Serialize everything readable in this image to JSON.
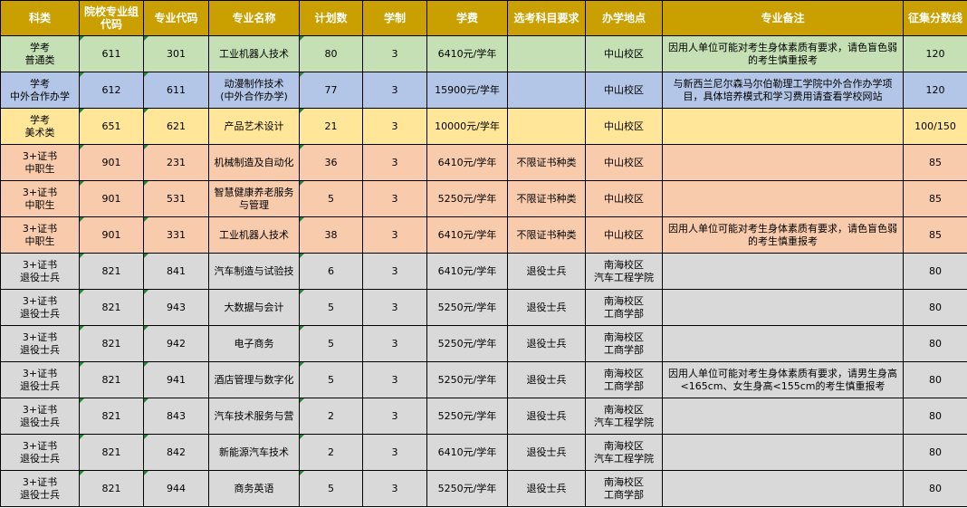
{
  "headers": [
    "科类",
    "院校专业组代码",
    "专业代码",
    "专业名称",
    "计划数",
    "学制",
    "学费",
    "选考科目要求",
    "办学地点",
    "专业备注",
    "征集分数线"
  ],
  "rows": [
    {
      "category": "学考\n普通类",
      "group_code": "611",
      "major_code": "301",
      "major_name": "工业机器人技术",
      "plan": "80",
      "years": "3",
      "tuition": "6410元/学年",
      "subject_req": "",
      "campus": "中山校区",
      "note": "因用人单位可能对考生身体素质有要求，请色盲色弱的考生慎重报考",
      "score": "120"
    },
    {
      "category": "学考\n中外合作办学",
      "group_code": "612",
      "major_code": "611",
      "major_name": "动漫制作技术\n(中外合作办学)",
      "plan": "77",
      "years": "3",
      "tuition": "15900元/学年",
      "subject_req": "",
      "campus": "中山校区",
      "note": "与新西兰尼尔森马尔伯勒理工学院中外合作办学项目，具体培养模式和学习费用请查看学校网站",
      "score": "120"
    },
    {
      "category": "学考\n美术类",
      "group_code": "651",
      "major_code": "621",
      "major_name": "产品艺术设计",
      "plan": "21",
      "years": "3",
      "tuition": "10000元/学年",
      "subject_req": "",
      "campus": "中山校区",
      "note": "",
      "score": "100/150"
    },
    {
      "category": "3+证书\n中职生",
      "group_code": "901",
      "major_code": "231",
      "major_name": "机械制造及自动化",
      "plan": "36",
      "years": "3",
      "tuition": "6410元/学年",
      "subject_req": "不限证书种类",
      "campus": "中山校区",
      "note": "",
      "score": "85"
    },
    {
      "category": "3+证书\n中职生",
      "group_code": "901",
      "major_code": "531",
      "major_name": "智慧健康养老服务与管理",
      "plan": "5",
      "years": "3",
      "tuition": "5250元/学年",
      "subject_req": "不限证书种类",
      "campus": "中山校区",
      "note": "",
      "score": "85"
    },
    {
      "category": "3+证书\n中职生",
      "group_code": "901",
      "major_code": "331",
      "major_name": "工业机器人技术",
      "plan": "38",
      "years": "3",
      "tuition": "6410元/学年",
      "subject_req": "不限证书种类",
      "campus": "中山校区",
      "note": "因用人单位可能对考生身体素质有要求，请色盲色弱的考生慎重报考",
      "score": "85"
    },
    {
      "category": "3+证书\n退役士兵",
      "group_code": "821",
      "major_code": "841",
      "major_name": "汽车制造与试验技",
      "plan": "6",
      "years": "3",
      "tuition": "6410元/学年",
      "subject_req": "退役士兵",
      "campus": "南海校区\n汽车工程学院",
      "note": "",
      "score": "80"
    },
    {
      "category": "3+证书\n退役士兵",
      "group_code": "821",
      "major_code": "943",
      "major_name": "大数据与会计",
      "plan": "5",
      "years": "3",
      "tuition": "5250元/学年",
      "subject_req": "退役士兵",
      "campus": "南海校区\n工商学部",
      "note": "",
      "score": "80"
    },
    {
      "category": "3+证书\n退役士兵",
      "group_code": "821",
      "major_code": "942",
      "major_name": "电子商务",
      "plan": "5",
      "years": "3",
      "tuition": "5250元/学年",
      "subject_req": "退役士兵",
      "campus": "南海校区\n工商学部",
      "note": "",
      "score": "80"
    },
    {
      "category": "3+证书\n退役士兵",
      "group_code": "821",
      "major_code": "941",
      "major_name": "酒店管理与数字化",
      "plan": "5",
      "years": "3",
      "tuition": "5250元/学年",
      "subject_req": "退役士兵",
      "campus": "南海校区\n工商学部",
      "note": "因用人单位可能对考生身体素质有要求，请男生身高<165cm、女生身高<155cm的考生慎重报考",
      "score": "80"
    },
    {
      "category": "3+证书\n退役士兵",
      "group_code": "821",
      "major_code": "843",
      "major_name": "汽车技术服务与营",
      "plan": "2",
      "years": "3",
      "tuition": "5250元/学年",
      "subject_req": "退役士兵",
      "campus": "南海校区\n汽车工程学院",
      "note": "",
      "score": "80"
    },
    {
      "category": "3+证书\n退役士兵",
      "group_code": "821",
      "major_code": "842",
      "major_name": "新能源汽车技术",
      "plan": "2",
      "years": "3",
      "tuition": "6410元/学年",
      "subject_req": "退役士兵",
      "campus": "南海校区\n汽车工程学院",
      "note": "",
      "score": "80"
    },
    {
      "category": "3+证书\n退役士兵",
      "group_code": "821",
      "major_code": "944",
      "major_name": "商务英语",
      "plan": "5",
      "years": "3",
      "tuition": "5250元/学年",
      "subject_req": "退役士兵",
      "campus": "南海校区\n工商学部",
      "note": "",
      "score": "80"
    }
  ]
}
